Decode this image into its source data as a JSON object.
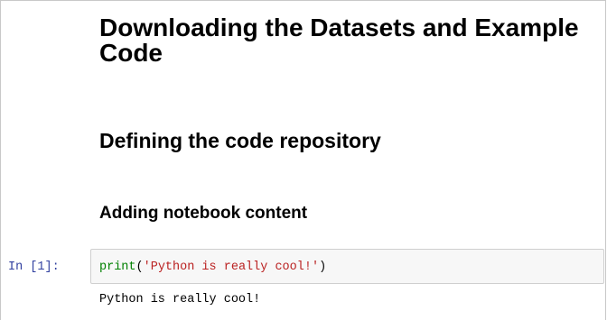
{
  "notebook": {
    "markdown": {
      "heading1": "Downloading the Datasets and Example Code",
      "heading2": "Defining the code repository",
      "heading3": "Adding notebook content"
    },
    "code_cell": {
      "prompt": "In [1]:",
      "code_builtin": "print",
      "code_open_paren": "(",
      "code_string": "'Python is really cool!'",
      "code_close_paren": ")",
      "output": "Python is really cool!"
    },
    "colors": {
      "prompt": "#303f9f",
      "builtin": "#008000",
      "string": "#ba2121",
      "input_background": "#f7f7f7",
      "input_border": "#cfcfcf"
    }
  }
}
